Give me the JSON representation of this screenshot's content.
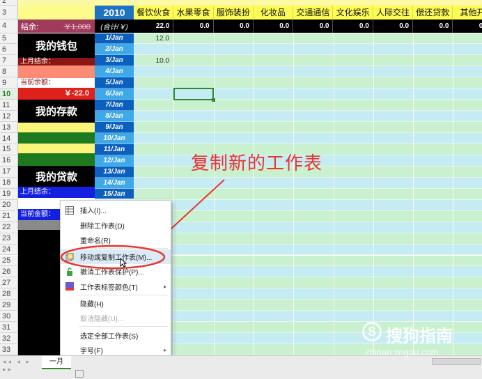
{
  "year": "2010",
  "categories": [
    "餐饮伙食",
    "水果零食",
    "服饰装扮",
    "化妆品",
    "交通通信",
    "文化娱乐",
    "人际交往",
    "偿还贷款",
    "其他开"
  ],
  "totals": [
    "22.0",
    "0.0",
    "0.0",
    "0.0",
    "0.0",
    "0.0",
    "0.0",
    "0.0",
    "0.0"
  ],
  "row4": {
    "label": "结余:",
    "value": "￥1,000",
    "subtotal": "(合计/￥)"
  },
  "row_numbers": [
    "2",
    "3",
    "4",
    "5",
    "6",
    "7",
    "8",
    "9",
    "10",
    "11",
    "12",
    "13",
    "14",
    "15",
    "16",
    "17",
    "18",
    "19",
    "20",
    "21",
    "22",
    "23",
    "24",
    "25",
    "26",
    "27",
    "28",
    "29",
    "30",
    "31",
    "32",
    "33"
  ],
  "dates": [
    "1/Jan",
    "2/Jan",
    "3/Jan",
    "4/Jan",
    "5/Jan",
    "6/Jan",
    "7/Jan",
    "8/Jan",
    "9/Jan",
    "10/Jan",
    "11/Jan",
    "12/Jan",
    "13/Jan",
    "14/Jan",
    "15/Jan"
  ],
  "entries": {
    "row5": "12.0",
    "row7": "10.0"
  },
  "wallet": {
    "title": "我的钱包",
    "last_balance_label": "上月结余：",
    "current_label": "当前余额：",
    "current_value": "￥-22.0"
  },
  "savings": {
    "title": "我的存款"
  },
  "loan": {
    "title": "我的贷款",
    "last_balance_label": "上月结余：",
    "current_label": "当前金额："
  },
  "annotation": "复制新的工作表",
  "context_menu": {
    "items": [
      {
        "label": "插入(I)...",
        "icon": "insert-sheet-icon",
        "disabled": false
      },
      {
        "label": "删除工作表(D)",
        "icon": "",
        "disabled": false
      },
      {
        "label": "重命名(R)",
        "icon": "",
        "disabled": false
      },
      {
        "label": "移动或复制工作表(M)...",
        "icon": "move-copy-icon",
        "disabled": false
      },
      {
        "label": "撤消工作表保护(P)...",
        "icon": "unprotect-icon",
        "disabled": false
      },
      {
        "label": "工作表标签颜色(T)",
        "icon": "tab-color-icon",
        "disabled": false
      },
      {
        "label": "隐藏(H)",
        "icon": "",
        "disabled": false
      },
      {
        "label": "取消隐藏(U)...",
        "icon": "",
        "disabled": true
      },
      {
        "label": "选定全部工作表(S)",
        "icon": "",
        "disabled": false
      },
      {
        "label": "字号(F)",
        "icon": "",
        "disabled": false
      }
    ]
  },
  "sheet_tab": {
    "label": "一月"
  },
  "watermark": {
    "brand": "搜狗指南",
    "url": "zhinan.sogou.com"
  },
  "colors": {
    "green_row": "#c9f0cf",
    "blue_row": "#c5ecf3",
    "header_yellow": "#fdfb55",
    "year_bg": "#1e72c2",
    "annotation_red": "#e8352e"
  }
}
